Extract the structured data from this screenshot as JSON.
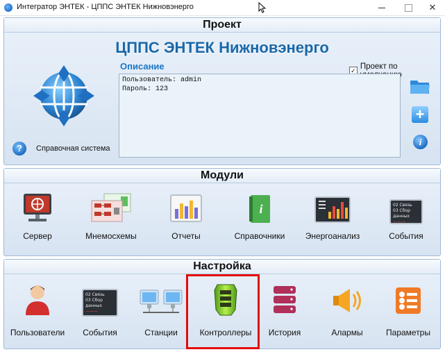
{
  "window": {
    "title": "Интегратор ЭНТЕК - ЦППС ЭНТЕК Нижновэнерго",
    "controls": [
      "minimize",
      "maximize",
      "close"
    ]
  },
  "project": {
    "header": "Проект",
    "name": "ЦППС ЭНТЕК Нижновэнерго",
    "description_label": "Описание",
    "description_lines": [
      "Пользователь: admin",
      "Пароль: 123"
    ],
    "default_checkbox_label": "Проект по умолчанию",
    "default_checked": true,
    "help_label": "Справочная система",
    "side_icons": [
      "folder-icon",
      "plus-icon",
      "info-icon"
    ]
  },
  "modules": {
    "header": "Модули",
    "items": [
      {
        "label": "Сервер",
        "icon": "server-icon"
      },
      {
        "label": "Мнемосхемы",
        "icon": "mnemonic-diagram-icon"
      },
      {
        "label": "Отчеты",
        "icon": "reports-chart-icon"
      },
      {
        "label": "Справочники",
        "icon": "reference-book-icon"
      },
      {
        "label": "Энергоанализ",
        "icon": "energy-analysis-icon"
      },
      {
        "label": "События",
        "icon": "events-monitor-icon"
      }
    ],
    "events_screen_text": [
      "02 Связь",
      "03 Сбор данных"
    ]
  },
  "settings": {
    "header": "Настройка",
    "items": [
      {
        "label": "Пользователи",
        "icon": "user-icon"
      },
      {
        "label": "События",
        "icon": "events-monitor-icon"
      },
      {
        "label": "Станции",
        "icon": "stations-icon"
      },
      {
        "label": "Контроллеры",
        "icon": "controller-icon",
        "highlighted": true
      },
      {
        "label": "История",
        "icon": "database-icon"
      },
      {
        "label": "Алармы",
        "icon": "alarm-horn-icon"
      },
      {
        "label": "Параметры",
        "icon": "parameters-list-icon"
      }
    ],
    "events_screen_text": [
      "02 Связь",
      "03 Сбор данных"
    ]
  },
  "colors": {
    "accent": "#1b68a8",
    "panel_bg": "#dfe9f5",
    "highlight": "#e30b0b"
  }
}
